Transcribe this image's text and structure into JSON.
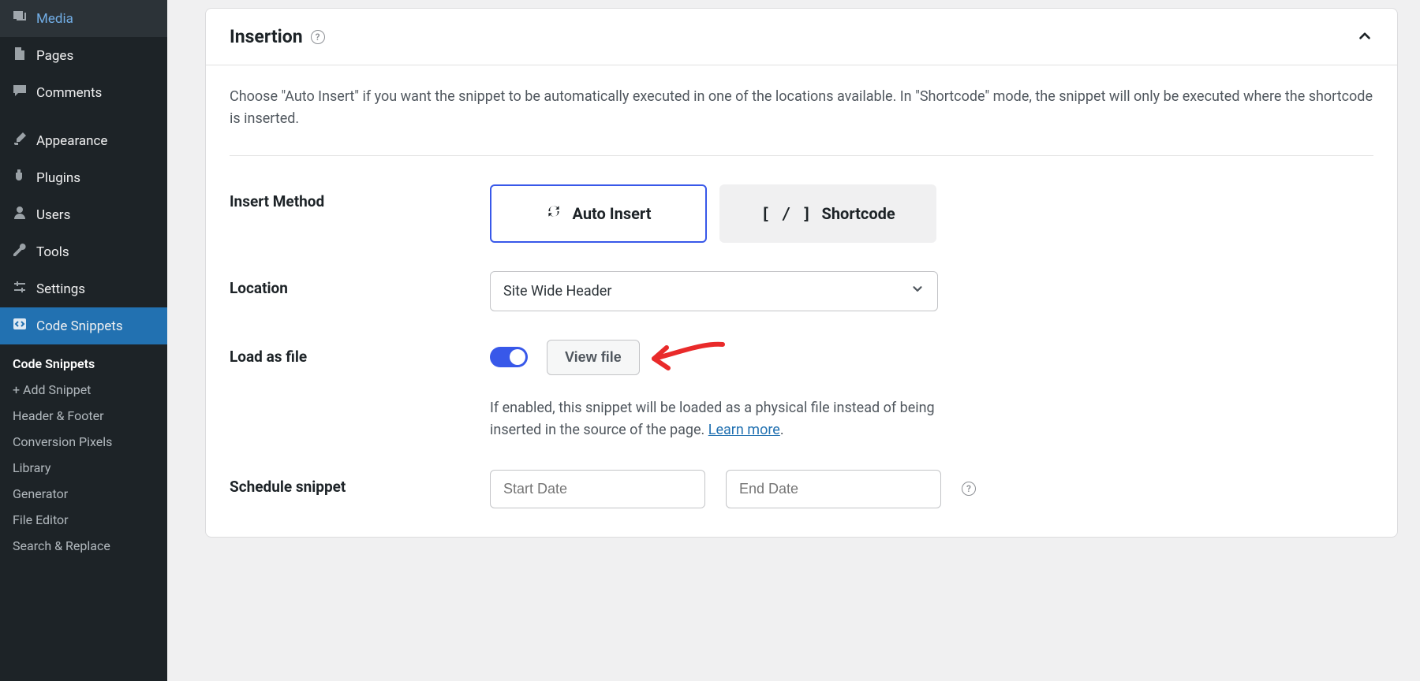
{
  "sidebar": {
    "top": [
      {
        "label": "Media",
        "icon": "media"
      },
      {
        "label": "Pages",
        "icon": "pages"
      },
      {
        "label": "Comments",
        "icon": "comment"
      }
    ],
    "mid": [
      {
        "label": "Appearance",
        "icon": "brush"
      },
      {
        "label": "Plugins",
        "icon": "plug"
      },
      {
        "label": "Users",
        "icon": "user"
      },
      {
        "label": "Tools",
        "icon": "wrench"
      },
      {
        "label": "Settings",
        "icon": "sliders"
      }
    ],
    "active": {
      "label": "Code Snippets",
      "icon": "code"
    },
    "sub": [
      {
        "label": "Code Snippets",
        "current": true
      },
      {
        "label": "+ Add Snippet"
      },
      {
        "label": "Header & Footer"
      },
      {
        "label": "Conversion Pixels"
      },
      {
        "label": "Library"
      },
      {
        "label": "Generator"
      },
      {
        "label": "File Editor"
      },
      {
        "label": "Search & Replace"
      }
    ]
  },
  "panel": {
    "title": "Insertion",
    "description": "Choose \"Auto Insert\" if you want the snippet to be automatically executed in one of the locations available. In \"Shortcode\" mode, the snippet will only be executed where the shortcode is inserted.",
    "fields": {
      "insert_method": {
        "label": "Insert Method",
        "auto": "Auto Insert",
        "shortcode": "Shortcode"
      },
      "location": {
        "label": "Location",
        "value": "Site Wide Header"
      },
      "load_file": {
        "label": "Load as file",
        "view": "View file",
        "note_before": "If enabled, this snippet will be loaded as a physical file instead of being inserted in the source of the page. ",
        "note_link": "Learn more",
        "note_after": "."
      },
      "schedule": {
        "label": "Schedule snippet",
        "start": "Start Date",
        "end": "End Date"
      }
    }
  }
}
